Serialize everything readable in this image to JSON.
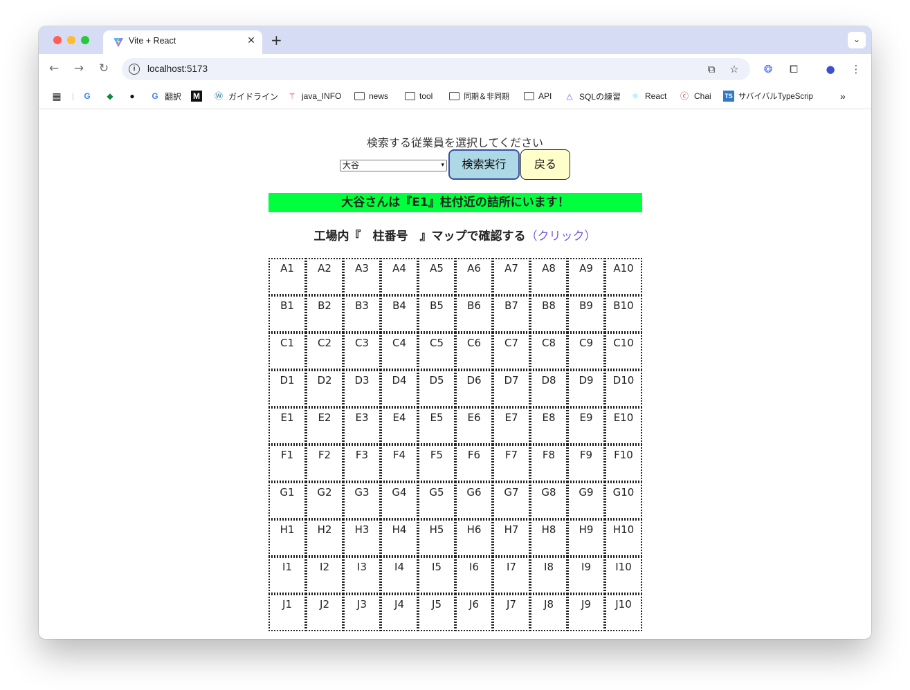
{
  "browser": {
    "tab_title": "Vite + React",
    "url": "localhost:5173",
    "bookmarks": [
      {
        "label": "",
        "icon": "google-icon"
      },
      {
        "label": "",
        "icon": "diamond-icon"
      },
      {
        "label": "",
        "icon": "github-icon"
      },
      {
        "label": "翻訳",
        "icon": "google-icon"
      },
      {
        "label": "",
        "icon": "m-icon"
      },
      {
        "label": "ガイドライン",
        "icon": "wordpress-icon"
      },
      {
        "label": "java_INFO",
        "icon": "person-icon"
      },
      {
        "label": "news",
        "icon": "folder-icon"
      },
      {
        "label": "tool",
        "icon": "folder-icon"
      },
      {
        "label": "同期＆非同期",
        "icon": "folder-icon"
      },
      {
        "label": "API",
        "icon": "folder-icon"
      },
      {
        "label": "SQLの練習",
        "icon": "triangle-icon"
      },
      {
        "label": "React",
        "icon": "react-icon"
      },
      {
        "label": "Chai",
        "icon": "chai-icon"
      },
      {
        "label": "サバイバルTypeScrip",
        "icon": "ts-icon"
      }
    ]
  },
  "page": {
    "prompt": "検索する従業員を選択してください",
    "selected_employee": "大谷",
    "search_button": "検索実行",
    "back_button": "戻る",
    "result_message": "大谷さんは『E1』柱付近の詰所にいます！",
    "map_text": "工場内『　柱番号　』マップで確認する",
    "map_link": "（クリック）",
    "grid_cells": [
      "A1",
      "A2",
      "A3",
      "A4",
      "A5",
      "A6",
      "A7",
      "A8",
      "A9",
      "A10",
      "B1",
      "B2",
      "B3",
      "B4",
      "B5",
      "B6",
      "B7",
      "B8",
      "B9",
      "B10",
      "C1",
      "C2",
      "C3",
      "C4",
      "C5",
      "C6",
      "C7",
      "C8",
      "C9",
      "C10",
      "D1",
      "D2",
      "D3",
      "D4",
      "D5",
      "D6",
      "D7",
      "D8",
      "D9",
      "D10",
      "E1",
      "E2",
      "E3",
      "E4",
      "E5",
      "E6",
      "E7",
      "E8",
      "E9",
      "E10",
      "F1",
      "F2",
      "F3",
      "F4",
      "F5",
      "F6",
      "F7",
      "F8",
      "F9",
      "F10",
      "G1",
      "G2",
      "G3",
      "G4",
      "G5",
      "G6",
      "G7",
      "G8",
      "G9",
      "G10",
      "H1",
      "H2",
      "H3",
      "H4",
      "H5",
      "H6",
      "H7",
      "H8",
      "H9",
      "H10",
      "I1",
      "I2",
      "I3",
      "I4",
      "I5",
      "I6",
      "I7",
      "I8",
      "I9",
      "I10",
      "J1",
      "J2",
      "J3",
      "J4",
      "J5",
      "J6",
      "J7",
      "J8",
      "J9",
      "J10"
    ]
  }
}
